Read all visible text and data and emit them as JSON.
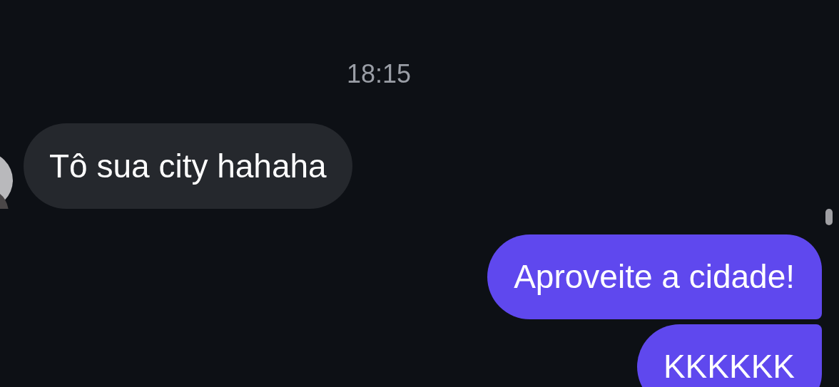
{
  "timestamp": "18:15",
  "messages": [
    {
      "kind": "received",
      "text": "Tô sua city hahaha"
    },
    {
      "kind": "sent",
      "text": "Aproveite a cidade!"
    },
    {
      "kind": "sent",
      "text": "KKKKKK"
    }
  ]
}
